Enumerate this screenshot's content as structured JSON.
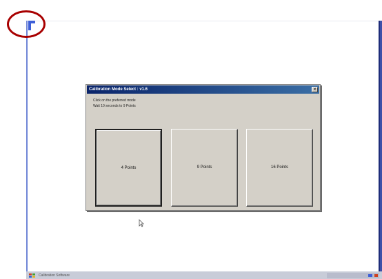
{
  "dialog": {
    "title": "Calibration Mode Select : v1.6",
    "close_icon": "close-icon",
    "instruction_line_1": "Click on the preferred mode",
    "instruction_line_2": "Wait 10 seconds to 9 Points",
    "buttons": [
      {
        "label": "4 Points"
      },
      {
        "label": "9 Points"
      },
      {
        "label": "16 Points"
      }
    ]
  },
  "taskbar": {
    "item_label": "Calibration Software",
    "start_icon": "windows-flag-icon"
  },
  "colors": {
    "titlebar_start": "#0a246a",
    "titlebar_end": "#3a6ea5",
    "dialog_face": "#d4d0c8",
    "annotation_circle": "#a80000",
    "corner_marker": "#3d5fd8"
  }
}
